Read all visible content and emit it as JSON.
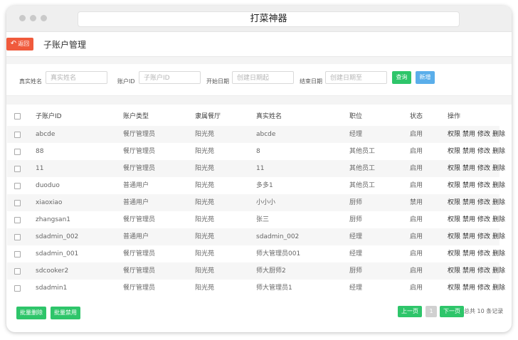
{
  "window": {
    "title": "打菜神器"
  },
  "page": {
    "back_label": "返回",
    "title": "子账户管理"
  },
  "filters": {
    "realname_label": "真实姓名",
    "realname_placeholder": "真实姓名",
    "account_label": "账户ID",
    "account_placeholder": "子账户ID",
    "start_label": "开始日期",
    "start_placeholder": "创建日期起",
    "end_label": "结束日期",
    "end_placeholder": "创建日期至",
    "query_label": "查询",
    "add_label": "新增"
  },
  "table": {
    "headers": [
      "子账户ID",
      "账户类型",
      "隶属餐厅",
      "真实姓名",
      "职位",
      "状态",
      "操作"
    ],
    "rows": [
      [
        "abcde",
        "餐厅管理员",
        "阳光苑",
        "abcde",
        "经理",
        "启用"
      ],
      [
        "88",
        "餐厅管理员",
        "阳光苑",
        "8",
        "其他员工",
        "启用"
      ],
      [
        "11",
        "餐厅管理员",
        "阳光苑",
        "11",
        "其他员工",
        "启用"
      ],
      [
        "duoduo",
        "普通用户",
        "阳光苑",
        "多多1",
        "其他员工",
        "启用"
      ],
      [
        "xiaoxiao",
        "普通用户",
        "阳光苑",
        "小小小",
        "厨师",
        "禁用"
      ],
      [
        "zhangsan1",
        "餐厅管理员",
        "阳光苑",
        "张三",
        "厨师",
        "启用"
      ],
      [
        "sdadmin_002",
        "普通用户",
        "阳光苑",
        "sdadmin_002",
        "经理",
        "启用"
      ],
      [
        "sdadmin_001",
        "餐厅管理员",
        "阳光苑",
        "师大管理员001",
        "经理",
        "启用"
      ],
      [
        "sdcooker2",
        "餐厅管理员",
        "阳光苑",
        "师大厨师2",
        "厨师",
        "启用"
      ],
      [
        "sdadmin1",
        "餐厅管理员",
        "阳光苑",
        "师大管理员1",
        "经理",
        "启用"
      ]
    ],
    "actions": [
      "权限",
      "禁用",
      "修改",
      "删除"
    ]
  },
  "footer": {
    "batch_delete": "批量删除",
    "batch_disable": "批量禁用",
    "prev": "上一页",
    "page": "1",
    "next": "下一页",
    "total": "总共 10 条记录"
  },
  "colors": {
    "green": "#2ec56a",
    "blue": "#5aaeea",
    "back": "#f05a3c"
  }
}
